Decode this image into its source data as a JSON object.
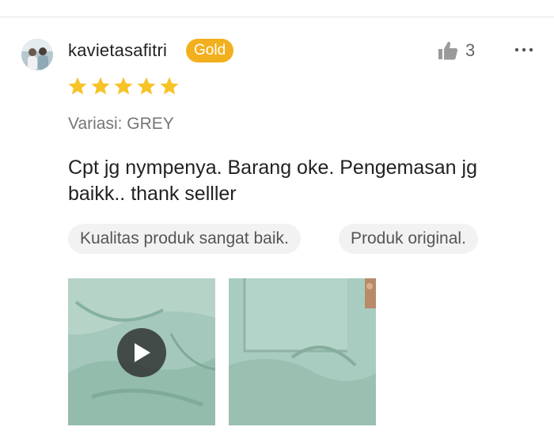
{
  "review": {
    "user": {
      "name": "kavietasafitri",
      "badge": "Gold",
      "avatar_icon": "avatar-photo"
    },
    "likes": {
      "count": "3",
      "icon": "thumbs-up-icon"
    },
    "more_icon": "more-dots-icon",
    "rating": 5,
    "rating_max": 5,
    "variant": "Variasi: GREY",
    "text": "Cpt jg nympenya. Barang oke. Pengemasan jg baikk.. thank selller",
    "tags": [
      "Kualitas produk sangat baik.",
      "Produk original."
    ],
    "media": [
      {
        "type": "video",
        "icon": "play-icon"
      },
      {
        "type": "image"
      }
    ]
  },
  "colors": {
    "badge": "#f2b01e",
    "star": "#f7c325",
    "tag_bg": "#f2f2f2",
    "fabric": "#9ec3b5"
  }
}
